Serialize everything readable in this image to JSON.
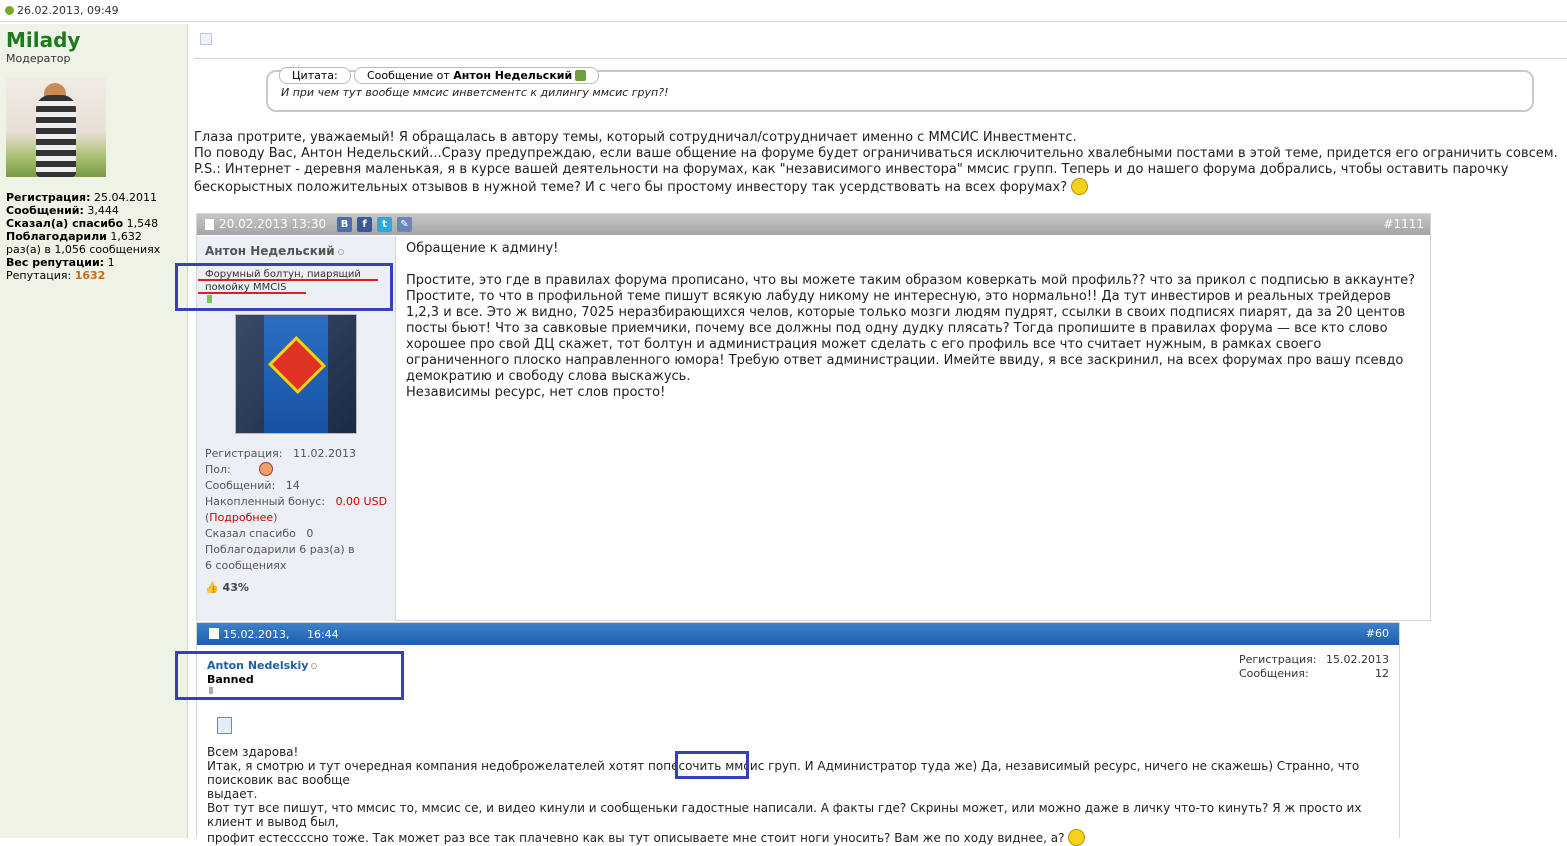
{
  "topbar": {
    "date": "26.02.2013, 09:49"
  },
  "sidebar": {
    "name": "Milady",
    "role": "Модератор",
    "stats": [
      {
        "label": "Регистрация:",
        "value": "25.04.2011"
      },
      {
        "label": "Сообщений:",
        "value": "3,444"
      },
      {
        "label": "Сказал(а) спасибо",
        "value": "1,548"
      },
      {
        "label": "Поблагодарили",
        "value": "1,632"
      }
    ],
    "thanks_line2": "раз(а) в 1,056 сообщениях",
    "rep_weight_label": "Вес репутации:",
    "rep_weight_value": "1",
    "reputation_label": "Репутация:",
    "reputation_value": "1632"
  },
  "quote": {
    "tab_label": "Цитата:",
    "from_prefix": "Сообщение от ",
    "from_author": "Антон Недельский",
    "text": "И при чем тут вообще ммсис инветсментс к дилингу ммсис груп?!"
  },
  "reply": {
    "lines": [
      "Глаза протрите, уважаемый! Я обращалась в автору темы, который сотрудничал/сотрудничает именно с ММСИС Инвестментс.",
      "По поводу Вас, Антон Недельский...Сразу предупреждаю, если ваше общение на форуме будет ограничиваться исключительно хвалебными постами в этой теме, придется его ограничить совсем.",
      "P.S.: Интернет - деревня маленькая, я в курсе вашей деятельности на форумах, как \"независимого инвестора\" ммсис групп. Теперь и до нашего форума добрались, чтобы оставить парочку",
      "бескорыстных положительных отзывов в нужной теме? И с чего бы простому инвестору так усердствовать на всех форумах?"
    ]
  },
  "post1": {
    "date": "20.02.2013 13:30",
    "number": "#1111",
    "social": [
      "B",
      "f",
      "t",
      "✎"
    ],
    "author": "Антон Недельский",
    "title": "Форумный болтун, пиарящий помойку MMCIS",
    "reg_label": "Регистрация:",
    "reg_value": "11.02.2013",
    "gender_label": "Пол:",
    "posts_label": "Сообщений:",
    "posts_value": "14",
    "bonus_label": "Накопленный бонус:",
    "bonus_value": "0.00 USD",
    "bonus_more": "Подробнее",
    "thanks_label": "Сказал спасибо",
    "thanks_value": "0",
    "thanked_line1": "Поблагодарили 6 раз(а) в",
    "thanked_line2": "6 сообщениях",
    "rating": "43%",
    "text_lines": [
      "Обращение к админу!",
      "",
      "Простите, это где в правилах форума прописано, что вы можете таким образом коверкать мой профиль?? что за прикол с подписью в аккаунте?",
      "Простите, то что в профильной теме пишут всякую лабуду никому не интересную, это нормально!! Да тут инвестиров и реальных трейдеров",
      "1,2,3 и все. Это ж видно, 7025 неразбирающихся челов, которые только мозги людям пудрят, ссылки в своих подписях пиарят, да за 20 центов",
      "посты бьют! Что за савковые приемчики, почему все должны под одну дудку плясать? Тогда пропишите в правилах форума — все кто слово",
      "хорошее про свой ДЦ скажет, тот болтун и администрация может сделать с его профиль все что считает нужным, в рамках своего",
      "ограниченного плоско направленного юмора! Требую ответ администрации. Имейте ввиду, я все заскринил, на всех форумах про вашу псевдо",
      "демократию и свободу слова выскажусь.",
      "Независимы ресурс, нет слов просто!"
    ]
  },
  "post2": {
    "date": "15.02.2013,",
    "time": "16:44",
    "number": "#60",
    "author": "Anton Nedelskiy",
    "status": "Banned",
    "reg_label": "Регистрация:",
    "reg_value": "15.02.2013",
    "posts_label": "Сообщения:",
    "posts_value": "12",
    "greeting": "Всем здарова!",
    "line1_a": "Итак, я смотрю и тут очередная компания недоброжелателей хотят попесочить ",
    "line1_hl": "ммсис груп",
    "line1_b": ". И Администратор туда же) Да, независимый ресурс, ничего не скажешь) Странно, что поисковик вас вообще",
    "line2": "выдает.",
    "line3": "Вот тут все пишут, что ммсис то, ммсис се, и видео кинули и сообщеньки гадостные написали. А факты где? Скрины может, или можно даже в личку что-то кинуть? Я ж просто их клиент и вывод был,",
    "line4": "профит естессссно тоже. Так может раз все так плачевно как вы тут описываете мне стоит ноги уносить? Вам же по ходу виднее, а?"
  },
  "colors": {
    "highlight_box": "#3840b8",
    "underline": "#e02020",
    "moderator_name": "#1f7a1f",
    "post2_header": "#1e5eaa"
  }
}
